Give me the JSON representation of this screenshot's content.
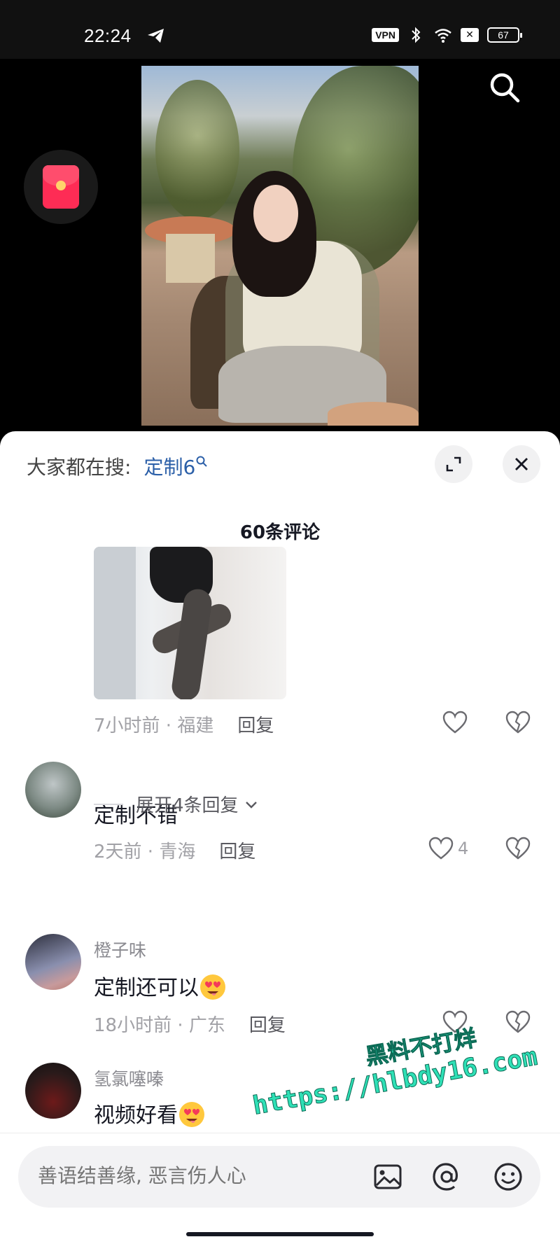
{
  "status_bar": {
    "time": "22:24",
    "vpn_label": "VPN",
    "battery": "67"
  },
  "search_bar": {
    "prefix": "大家都在搜:",
    "keyword": "定制6"
  },
  "comments_header": {
    "count_label": "60条评论"
  },
  "comments": [
    {
      "has_image": true,
      "time_location": "7小时前 · 福建",
      "reply_label": "回复"
    },
    {
      "username": "",
      "text": "定制不错",
      "time_location": "2天前 · 青海",
      "reply_label": "回复",
      "like_count": "4",
      "expand_label": "展开4条回复"
    },
    {
      "username": "橙子味",
      "text": "定制还可以",
      "time_location": "18小时前 · 广东",
      "reply_label": "回复"
    },
    {
      "username": "氢氯噻嗪",
      "text": "视频好看"
    }
  ],
  "watermark": {
    "line1": "黑料不打烊",
    "line2": "https://hlbdy16.com"
  },
  "input_bar": {
    "placeholder": "善语结善缘, 恶言伤人心"
  },
  "icons": [
    "telegram-icon",
    "bluetooth-icon",
    "wifi-icon",
    "search-icon",
    "red-packet-icon",
    "expand-icon",
    "close-icon",
    "heart-icon",
    "broken-heart-icon",
    "chevron-down-icon",
    "image-icon",
    "at-icon",
    "emoji-icon"
  ],
  "colors": {
    "keyword": "#2b5fa8",
    "watermark": "#2fe0b6",
    "red_packet": "#fe2c55"
  }
}
